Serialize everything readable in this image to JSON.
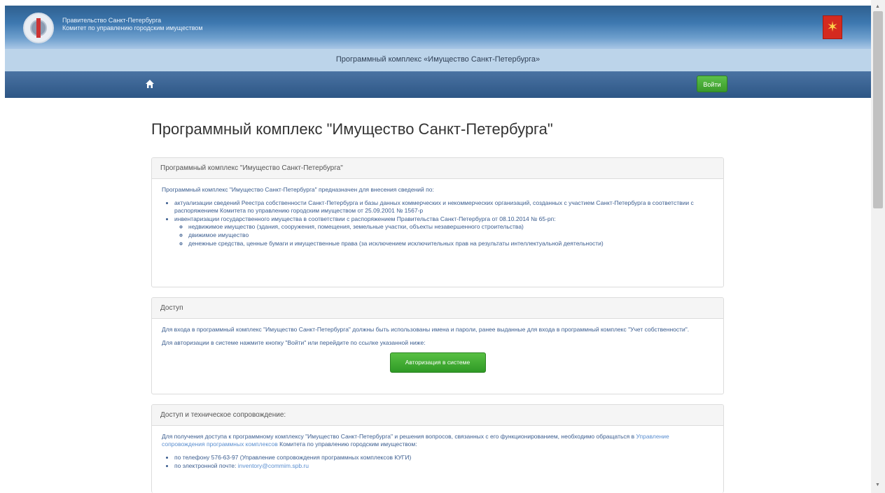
{
  "header": {
    "org_line1": "Правительство Санкт-Петербурга",
    "org_line2": "Комитет по управлению городским имуществом",
    "subtitle": "Программный комплекс «Имущество Санкт-Петербурга»",
    "coat_icon": "coat-of-arms-icon"
  },
  "nav": {
    "home_icon": "home-icon",
    "login_label": "Войти"
  },
  "main": {
    "title": "Программный комплекс \"Имущество Санкт-Петербурга\"",
    "panel1": {
      "heading": "Программный комплекс \"Имущество Санкт-Петербурга\"",
      "intro": "Программный комплекс \"Имущество Санкт-Петербурга\" предназначен для внесения сведений по:",
      "items": [
        "актуализации сведений Реестра собственности Санкт-Петербурга и базы данных коммерческих и некоммерческих организаций, созданных с участием Санкт-Петербурга в соответствии с распоряжением Комитета по управлению городским имуществом от 25.09.2001 № 1567-р",
        "инвентаризации государственного имущества в соответствии с распоряжением Правительства Санкт-Петербурга от 08.10.2014 № 65-рп:"
      ],
      "subitems": [
        "недвижимое имущество (здания, сооружения, помещения, земельные участки, объекты незавершенного строительства)",
        "движимое имущество",
        "денежные средства, ценные бумаги и имущественные права (за исключением исключительных прав на результаты интеллектуальной деятельности)"
      ]
    },
    "panel2": {
      "heading": "Доступ",
      "text1": "Для входа в программный комплекс \"Имущество Санкт-Петербурга\" должны быть использованы имена и пароли, ранее выданные для входа в программный комплекс \"Учет собственности\".",
      "text2": "Для авторизации в системе нажмите кнопку \"Войти\" или перейдите по ссылке указанной ниже:",
      "button": "Авторизация в системе"
    },
    "panel3": {
      "heading": "Доступ и техническое сопровождение:",
      "text_before": "Для получения доступа к программному комплексу \"Имущество Санкт-Петербурга\" и решения вопросов, связанных с его функционированием, необходимо обращаться в",
      "link": "Управление сопровождения программных комплексов",
      "text_after": "Комитета по управлению городским имуществом:",
      "contact_phone": "по телефону 576-63-97 (Управление сопровождения программных комплексов КУГИ)",
      "contact_email_prefix": "по электронной почте:",
      "contact_email": "inventory@commim.spb.ru"
    }
  },
  "colors": {
    "header_blue": "#3d78b0",
    "nav_blue": "#2d5685",
    "green_button": "#3a9a2a",
    "link_blue": "#5b8fd0"
  }
}
